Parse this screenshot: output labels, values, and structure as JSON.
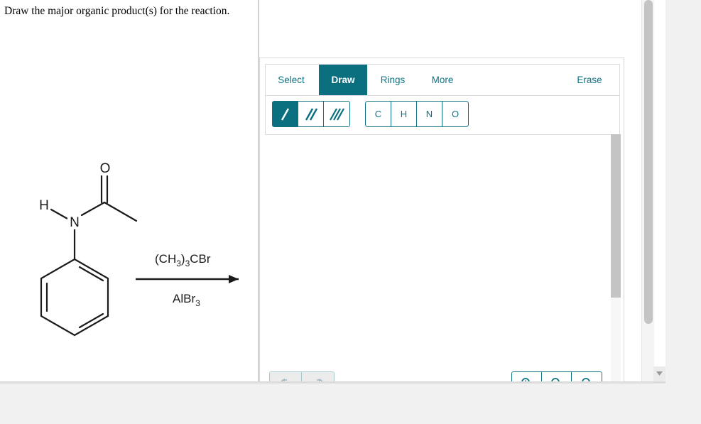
{
  "prompt": {
    "text": "Draw the major organic product(s) for the reaction."
  },
  "reaction": {
    "reactant_name": "acetanilide",
    "atom_labels": {
      "h": "H",
      "n": "N",
      "o": "O"
    },
    "reagent_above": "(CH3)3CBr",
    "reagent_above_parts": {
      "open": "(CH",
      "sub1": "3",
      "close_sub": ")",
      "sub2": "3",
      "tail": "CBr"
    },
    "reagent_below": "AlBr3",
    "reagent_below_parts": {
      "main": "AlBr",
      "sub": "3"
    },
    "arrow": "reaction-arrow"
  },
  "editor": {
    "tabs": [
      {
        "id": "select",
        "label": "Select",
        "active": false
      },
      {
        "id": "draw",
        "label": "Draw",
        "active": true
      },
      {
        "id": "rings",
        "label": "Rings",
        "active": false
      },
      {
        "id": "more",
        "label": "More",
        "active": false
      }
    ],
    "erase_label": "Erase",
    "bond_tools": [
      {
        "id": "single",
        "name": "single-bond",
        "active": true
      },
      {
        "id": "double",
        "name": "double-bond",
        "active": false
      },
      {
        "id": "triple",
        "name": "triple-bond",
        "active": false
      }
    ],
    "element_tools": [
      {
        "id": "C",
        "label": "C"
      },
      {
        "id": "H",
        "label": "H"
      },
      {
        "id": "N",
        "label": "N"
      },
      {
        "id": "O",
        "label": "O"
      }
    ],
    "bottom_controls": {
      "history": [
        {
          "id": "undo",
          "name": "undo-button",
          "enabled": false
        },
        {
          "id": "redo",
          "name": "redo-button",
          "enabled": false
        }
      ],
      "zoom": [
        {
          "id": "zoom-in",
          "name": "zoom-in-button"
        },
        {
          "id": "zoom-out",
          "name": "zoom-out-button"
        },
        {
          "id": "zoom-reset",
          "name": "zoom-reset-button"
        }
      ]
    }
  },
  "colors": {
    "accent_teal": "#0a7080",
    "accent_teal_text": "#0d7383",
    "panel_border": "#dcdcdc",
    "scrollbar_thumb": "#c4c4c4",
    "page_background": "#f1f1f1",
    "canvas_background": "#ffffff",
    "structure_stroke": "#1a1a1a"
  }
}
